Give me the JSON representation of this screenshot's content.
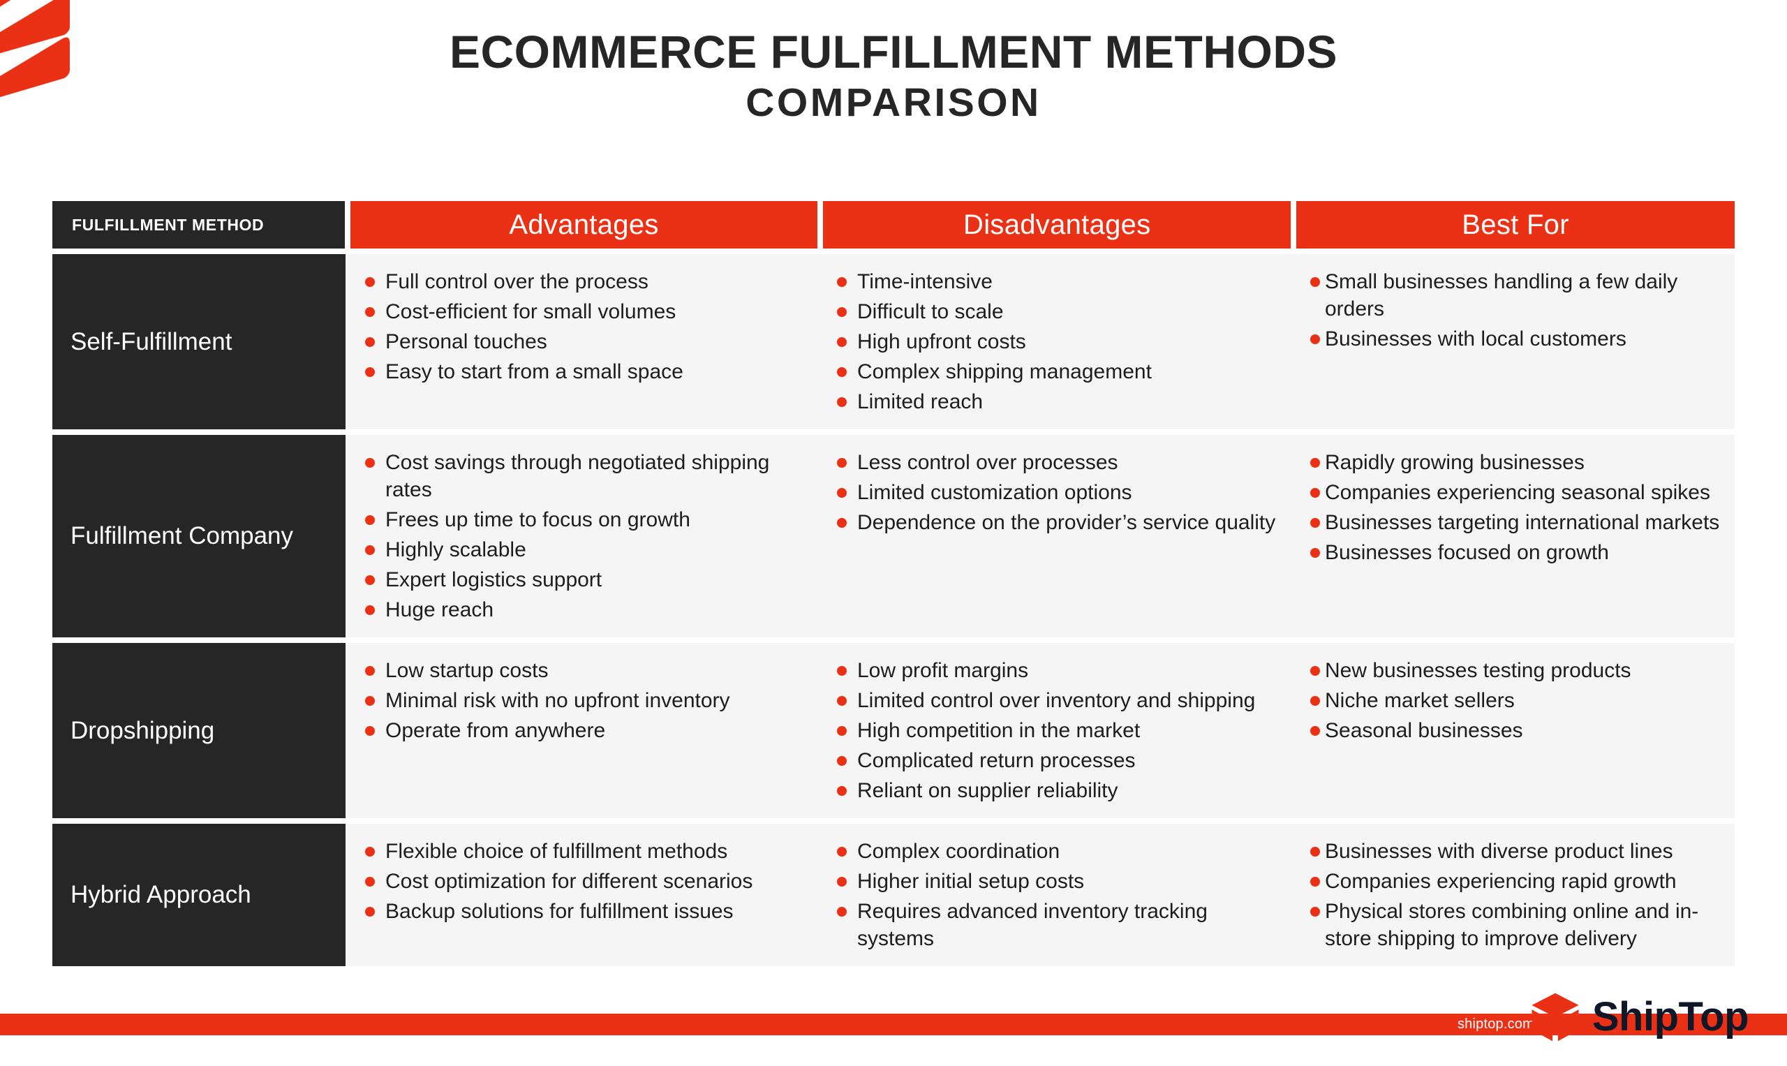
{
  "title": {
    "line1": "ECOMMERCE FULFILLMENT METHODS",
    "line2": "COMPARISON"
  },
  "colors": {
    "accent_red": "#EA3116",
    "dark": "#262626",
    "cell_bg": "#f5f5f5",
    "brand_navy": "#101828"
  },
  "table": {
    "headers": {
      "method": "FULFILLMENT METHOD",
      "advantages": "Advantages",
      "disadvantages": "Disadvantages",
      "best_for": "Best For"
    },
    "rows": [
      {
        "method": "Self-Fulfillment",
        "advantages": [
          "Full control over the process",
          "Cost-efficient for small volumes",
          "Personal touches",
          "Easy to start from a small space"
        ],
        "disadvantages": [
          "Time-intensive",
          "Difficult to scale",
          "High upfront costs",
          "Complex shipping management",
          "Limited reach"
        ],
        "best_for": [
          "Small businesses handling a few daily orders",
          "Businesses with local customers"
        ]
      },
      {
        "method": "Fulfillment Company",
        "advantages": [
          "Cost savings through negotiated shipping rates",
          "Frees up time to focus on growth",
          "Highly scalable",
          "Expert logistics support",
          "Huge reach"
        ],
        "disadvantages": [
          "Less control over processes",
          "Limited customization options",
          "Dependence on the provider’s service quality"
        ],
        "best_for": [
          "Rapidly growing businesses",
          "Companies experiencing seasonal spikes",
          "Businesses targeting international markets",
          "Businesses focused on growth"
        ]
      },
      {
        "method": "Dropshipping",
        "advantages": [
          "Low startup costs",
          "Minimal risk with no upfront inventory",
          "Operate from anywhere"
        ],
        "disadvantages": [
          "Low profit margins",
          "Limited control over inventory and shipping",
          "High competition in the market",
          "Complicated return processes",
          "Reliant on supplier reliability"
        ],
        "best_for": [
          "New businesses testing products",
          "Niche market sellers",
          "Seasonal businesses"
        ]
      },
      {
        "method": "Hybrid Approach",
        "advantages": [
          "Flexible choice of fulfillment methods",
          "Cost optimization for different scenarios",
          "Backup solutions for fulfillment issues"
        ],
        "disadvantages": [
          "Complex coordination",
          "Higher initial setup costs",
          "Requires advanced inventory tracking systems"
        ],
        "best_for": [
          "Businesses with diverse product lines",
          "Companies experiencing rapid growth",
          "Physical stores combining online and in-store shipping to improve delivery"
        ]
      }
    ]
  },
  "footer": {
    "url": "shiptop.com",
    "brand": "ShipTop"
  }
}
